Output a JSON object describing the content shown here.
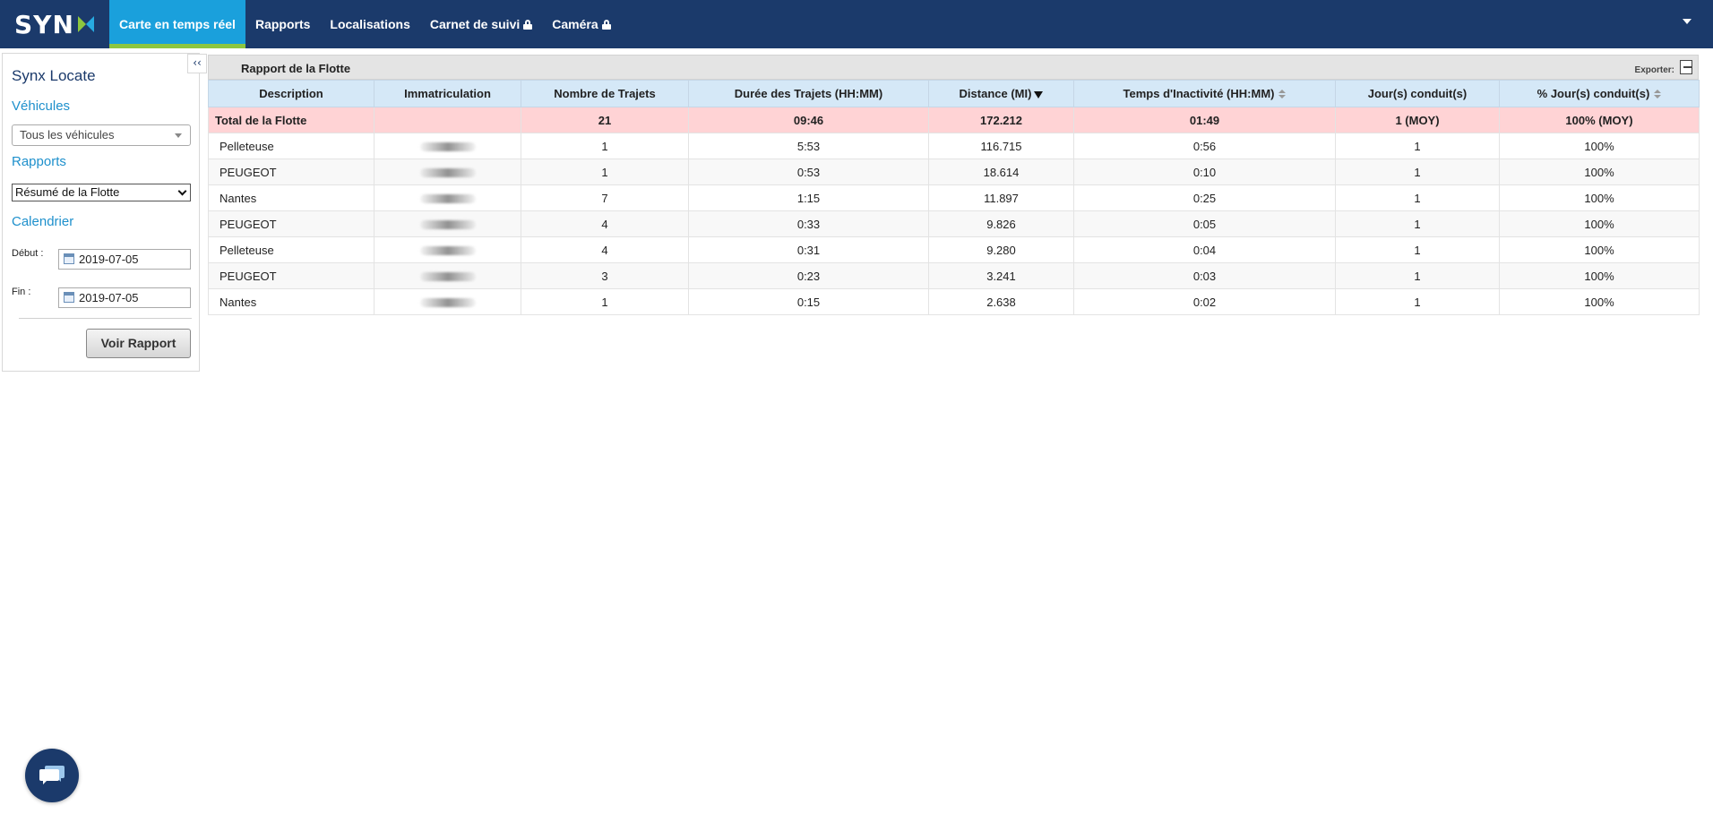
{
  "brand": {
    "logo_text": "SYN"
  },
  "nav": {
    "items": [
      {
        "label": "Carte en temps réel",
        "active": true,
        "locked": false
      },
      {
        "label": "Rapports",
        "active": false,
        "locked": false
      },
      {
        "label": "Localisations",
        "active": false,
        "locked": false
      },
      {
        "label": "Carnet de suivi",
        "active": false,
        "locked": true
      },
      {
        "label": "Caméra",
        "active": false,
        "locked": true
      }
    ]
  },
  "sidebar": {
    "collapse_label": "‹‹",
    "title": "Synx Locate",
    "vehicles_heading": "Véhicules",
    "vehicles_select": "Tous les véhicules",
    "reports_heading": "Rapports",
    "report_select": "Résumé de la Flotte",
    "calendar_heading": "Calendrier",
    "start_label": "Début :",
    "start_value": "2019-07-05",
    "end_label": "Fin :",
    "end_value": "2019-07-05",
    "submit_label": "Voir Rapport"
  },
  "report": {
    "title": "Rapport de la Flotte",
    "export_label": "Exporter:",
    "columns": [
      "Description",
      "Immatriculation",
      "Nombre de Trajets",
      "Durée des Trajets (HH:MM)",
      "Distance (MI)",
      "Temps d'Inactivité (HH:MM)",
      "Jour(s) conduit(s)",
      "% Jour(s) conduit(s)"
    ],
    "total": {
      "description": "Total de la Flotte",
      "plate": "",
      "trips": "21",
      "duration": "09:46",
      "distance": "172.212",
      "idle": "01:49",
      "days": "1 (MOY)",
      "pct": "100% (MOY)"
    },
    "rows": [
      {
        "description": "Pelleteuse",
        "trips": "1",
        "duration": "5:53",
        "distance": "116.715",
        "idle": "0:56",
        "days": "1",
        "pct": "100%"
      },
      {
        "description": "PEUGEOT",
        "trips": "1",
        "duration": "0:53",
        "distance": "18.614",
        "idle": "0:10",
        "days": "1",
        "pct": "100%"
      },
      {
        "description": "Nantes",
        "trips": "7",
        "duration": "1:15",
        "distance": "11.897",
        "idle": "0:25",
        "days": "1",
        "pct": "100%"
      },
      {
        "description": "PEUGEOT",
        "trips": "4",
        "duration": "0:33",
        "distance": "9.826",
        "idle": "0:05",
        "days": "1",
        "pct": "100%"
      },
      {
        "description": "Pelleteuse",
        "trips": "4",
        "duration": "0:31",
        "distance": "9.280",
        "idle": "0:04",
        "days": "1",
        "pct": "100%"
      },
      {
        "description": "PEUGEOT",
        "trips": "3",
        "duration": "0:23",
        "distance": "3.241",
        "idle": "0:03",
        "days": "1",
        "pct": "100%"
      },
      {
        "description": "Nantes",
        "trips": "1",
        "duration": "0:15",
        "distance": "2.638",
        "idle": "0:02",
        "days": "1",
        "pct": "100%"
      }
    ]
  },
  "colors": {
    "navbar": "#1b3a6b",
    "nav_active": "#1aa0dc",
    "nav_active_underline": "#8dc63f",
    "table_header": "#d5e8f7",
    "total_row": "#ffd3d5",
    "sidebar_heading": "#1e90cc"
  },
  "icons": [
    "lock-icon",
    "chevron-down-icon",
    "calendar-icon",
    "export-icon",
    "chat-icon",
    "sort-desc-icon",
    "sort-icon"
  ]
}
